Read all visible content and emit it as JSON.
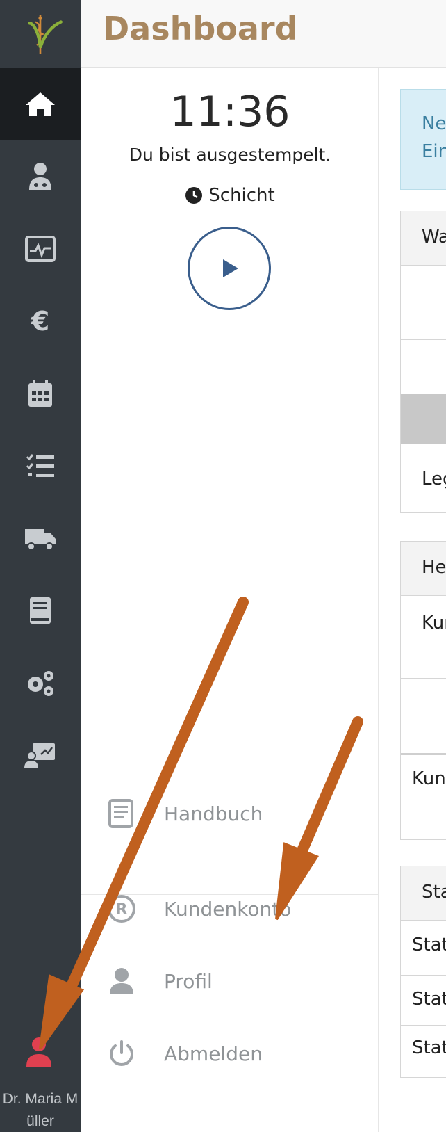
{
  "header": {
    "title": "Dashboard"
  },
  "sidebar": {
    "logo_icon": "caduceus-logo",
    "items": [
      {
        "name": "home",
        "icon": "home-icon",
        "active": true
      },
      {
        "name": "patients",
        "icon": "doctor-icon",
        "active": false
      },
      {
        "name": "monitor",
        "icon": "heartbeat-icon",
        "active": false
      },
      {
        "name": "finance",
        "icon": "euro-icon",
        "active": false
      },
      {
        "name": "calendar",
        "icon": "calendar-icon",
        "active": false
      },
      {
        "name": "tasks",
        "icon": "tasks-icon",
        "active": false
      },
      {
        "name": "delivery",
        "icon": "truck-icon",
        "active": false
      },
      {
        "name": "book",
        "icon": "book-icon",
        "active": false
      },
      {
        "name": "settings",
        "icon": "gears-icon",
        "active": false
      },
      {
        "name": "presentation",
        "icon": "teacher-icon",
        "active": false
      }
    ],
    "user": {
      "name": "Dr. Maria Müller",
      "icon": "user-icon",
      "color": "#e04050"
    }
  },
  "time_panel": {
    "clock": "11:36",
    "status": "Du bist ausgestempelt.",
    "shift_label": "Schicht"
  },
  "menu": {
    "handbook": "Handbuch",
    "account": "Kundenkonto",
    "profile": "Profil",
    "logout": "Abmelden"
  },
  "content": {
    "alert_line1": "Ne",
    "alert_line2": "Ein",
    "card1": {
      "header": "Wa",
      "row": "Leg"
    },
    "card2": {
      "header": "He",
      "row1": "Kur",
      "row2": "Kund"
    },
    "card3": {
      "header": "Sta",
      "row1": "Stat",
      "row2": "Stat",
      "row3": "Stat"
    }
  },
  "colors": {
    "sidebar": "#343a40",
    "accent_title": "#a8875f",
    "play_button": "#3a5e8c",
    "annotation_arrow": "#c0601f"
  }
}
